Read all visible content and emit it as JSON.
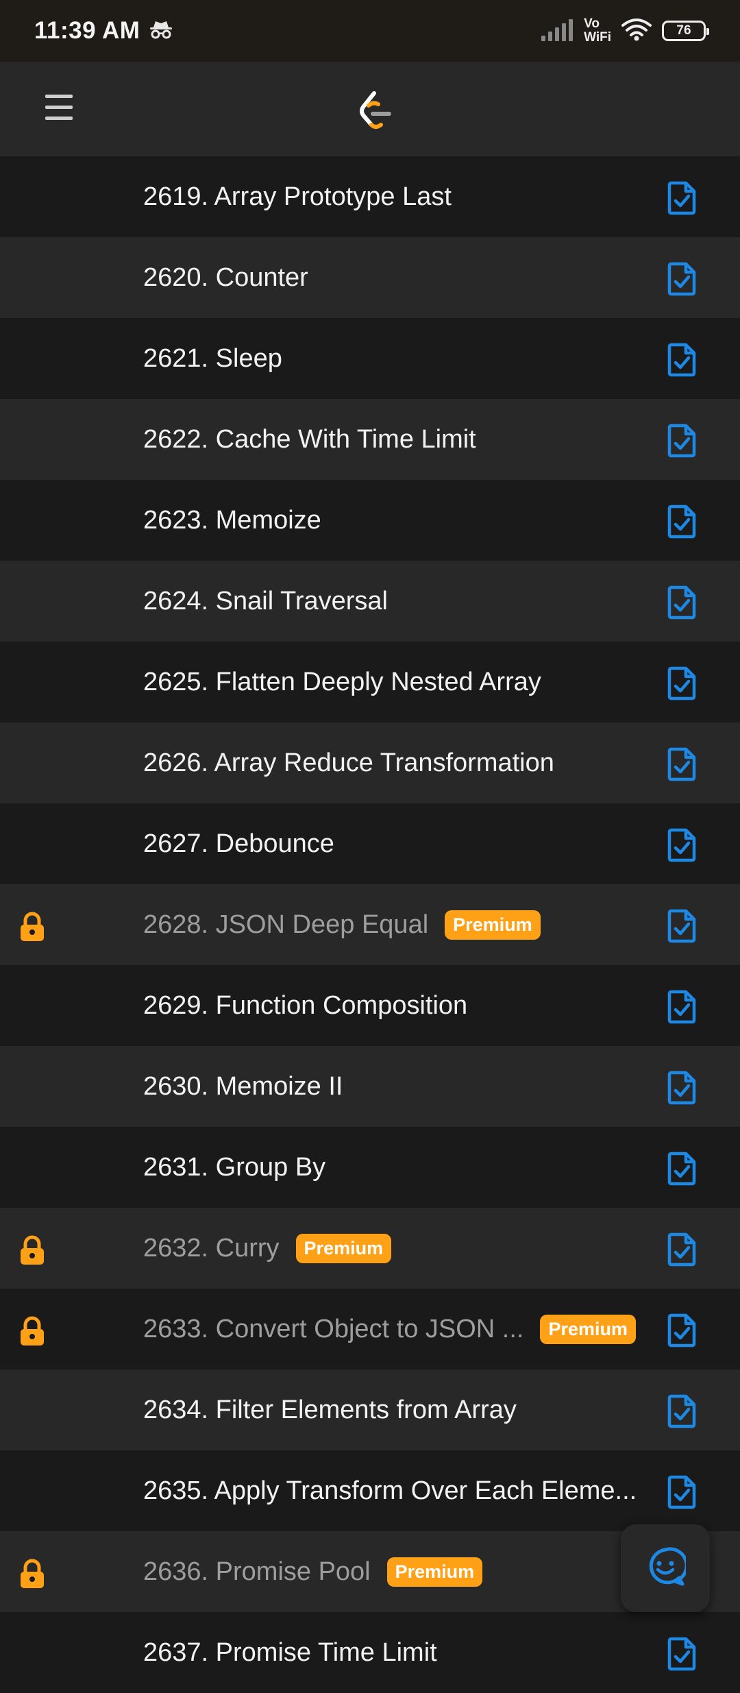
{
  "status_bar": {
    "time": "11:39 AM",
    "incognito_icon": "incognito-icon",
    "signal_icon": "signal-icon",
    "vowifi_top": "Vo",
    "vowifi_bottom": "WiFi",
    "wifi_icon": "wifi-icon",
    "battery_level": "76"
  },
  "header": {
    "menu_icon": "hamburger-menu-icon",
    "logo_icon": "leetcode-logo-icon"
  },
  "colors": {
    "accent": "#ffa116",
    "check_icon": "#1e88e5",
    "row_dark": "#1a1a1a",
    "row_light": "#282828"
  },
  "problems": [
    {
      "title": "2619. Array Prototype Last",
      "premium": false
    },
    {
      "title": "2620. Counter",
      "premium": false
    },
    {
      "title": "2621. Sleep",
      "premium": false
    },
    {
      "title": "2622. Cache With Time Limit",
      "premium": false
    },
    {
      "title": "2623. Memoize",
      "premium": false
    },
    {
      "title": "2624. Snail Traversal",
      "premium": false
    },
    {
      "title": "2625. Flatten Deeply Nested Array",
      "premium": false
    },
    {
      "title": "2626. Array Reduce Transformation",
      "premium": false
    },
    {
      "title": "2627. Debounce",
      "premium": false
    },
    {
      "title": "2628. JSON Deep Equal",
      "premium": true,
      "badge": "Premium"
    },
    {
      "title": "2629. Function Composition",
      "premium": false
    },
    {
      "title": "2630. Memoize II",
      "premium": false
    },
    {
      "title": "2631. Group By",
      "premium": false
    },
    {
      "title": "2632. Curry",
      "premium": true,
      "badge": "Premium"
    },
    {
      "title": "2633. Convert Object to JSON ...",
      "premium": true,
      "badge": "Premium"
    },
    {
      "title": "2634. Filter Elements from Array",
      "premium": false
    },
    {
      "title": "2635. Apply Transform Over Each Eleme...",
      "premium": false
    },
    {
      "title": "2636. Promise Pool",
      "premium": true,
      "badge": "Premium"
    },
    {
      "title": "2637. Promise Time Limit",
      "premium": false
    }
  ],
  "fab": {
    "icon": "chat-smiley-icon"
  }
}
